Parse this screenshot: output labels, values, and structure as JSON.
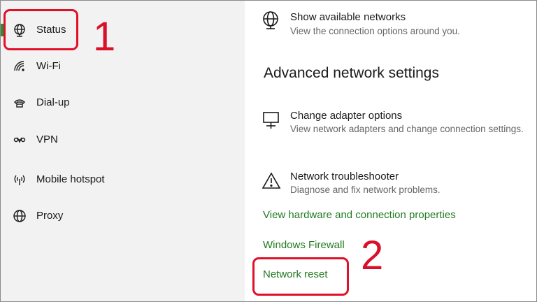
{
  "sidebar": {
    "items": [
      {
        "label": "Status",
        "icon": "globe-icon"
      },
      {
        "label": "Wi-Fi",
        "icon": "wifi-icon"
      },
      {
        "label": "Dial-up",
        "icon": "phone-icon"
      },
      {
        "label": "VPN",
        "icon": "vpn-icon"
      },
      {
        "label": "Mobile hotspot",
        "icon": "hotspot-icon"
      },
      {
        "label": "Proxy",
        "icon": "globe-icon"
      }
    ],
    "accent_color": "#2e8b2e"
  },
  "main": {
    "show_networks": {
      "title": "Show available networks",
      "desc": "View the connection options around you."
    },
    "section_heading": "Advanced network settings",
    "change_adapter": {
      "title": "Change adapter options",
      "desc": "View network adapters and change connection settings."
    },
    "troubleshooter": {
      "title": "Network troubleshooter",
      "desc": "Diagnose and fix network problems."
    },
    "links": {
      "hardware": "View hardware and connection properties",
      "firewall": "Windows Firewall",
      "reset": "Network reset"
    },
    "link_color": "#217a21"
  },
  "annotations": {
    "label_1": "1",
    "label_2": "2",
    "color": "#e0102a"
  }
}
